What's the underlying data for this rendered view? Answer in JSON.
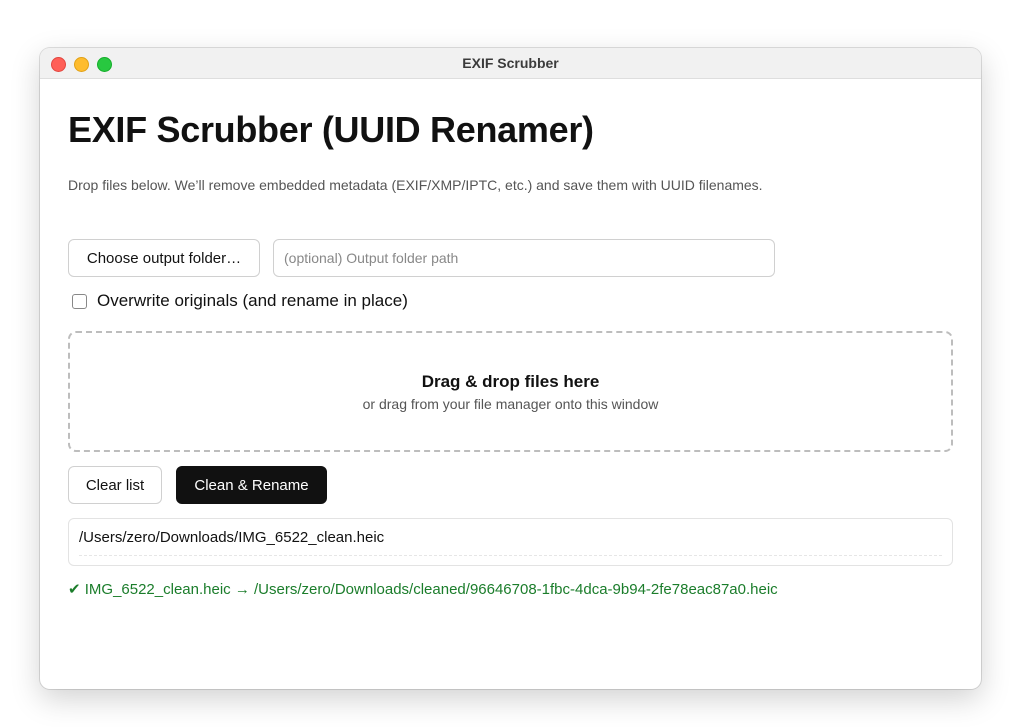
{
  "window": {
    "title": "EXIF Scrubber"
  },
  "main": {
    "heading": "EXIF Scrubber (UUID Renamer)",
    "subtitle": "Drop files below. We’ll remove embedded metadata (EXIF/XMP/IPTC, etc.) and save them with UUID filenames.",
    "choose_folder_label": "Choose output folder…",
    "output_path": {
      "value": "",
      "placeholder": "(optional) Output folder path"
    },
    "overwrite": {
      "label": "Overwrite originals (and rename in place)",
      "checked": false
    },
    "dropzone": {
      "title": "Drag & drop files here",
      "subtitle": "or drag from your file manager onto this window"
    },
    "clear_label": "Clear list",
    "clean_label": "Clean & Rename",
    "files": [
      "/Users/zero/Downloads/IMG_6522_clean.heic"
    ],
    "result": "✔ IMG_6522_clean.heic → /Users/zero/Downloads/cleaned/96646708-1fbc-4dca-9b94-2fe78eac87a0.heic"
  },
  "colors": {
    "primary_button": "#111111",
    "success_text": "#1b7d2b",
    "traffic_close": "#ff5f57",
    "traffic_minimize": "#febc2e",
    "traffic_maximize": "#28c840"
  }
}
